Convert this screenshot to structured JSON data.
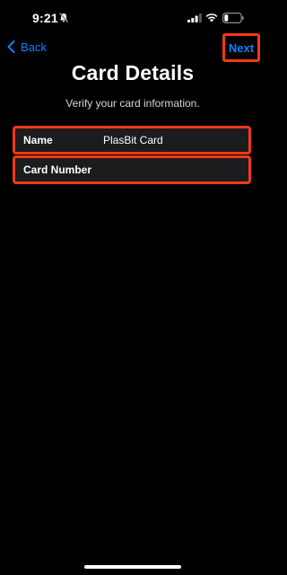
{
  "status_bar": {
    "time": "9:21",
    "icons": [
      "bell-slash-icon",
      "signal-icon",
      "wifi-icon",
      "battery-icon"
    ],
    "battery_level": 0.2
  },
  "nav": {
    "back_label": "Back",
    "next_label": "Next"
  },
  "page": {
    "title": "Card Details",
    "subtitle": "Verify your card information."
  },
  "form": {
    "name": {
      "label": "Name",
      "value": "PlasBit Card"
    },
    "card_number": {
      "label": "Card Number",
      "value": ""
    }
  },
  "colors": {
    "accent": "#0a84ff",
    "highlight": "#f03a17",
    "background": "#000000",
    "row_background": "#1c1c1e"
  }
}
